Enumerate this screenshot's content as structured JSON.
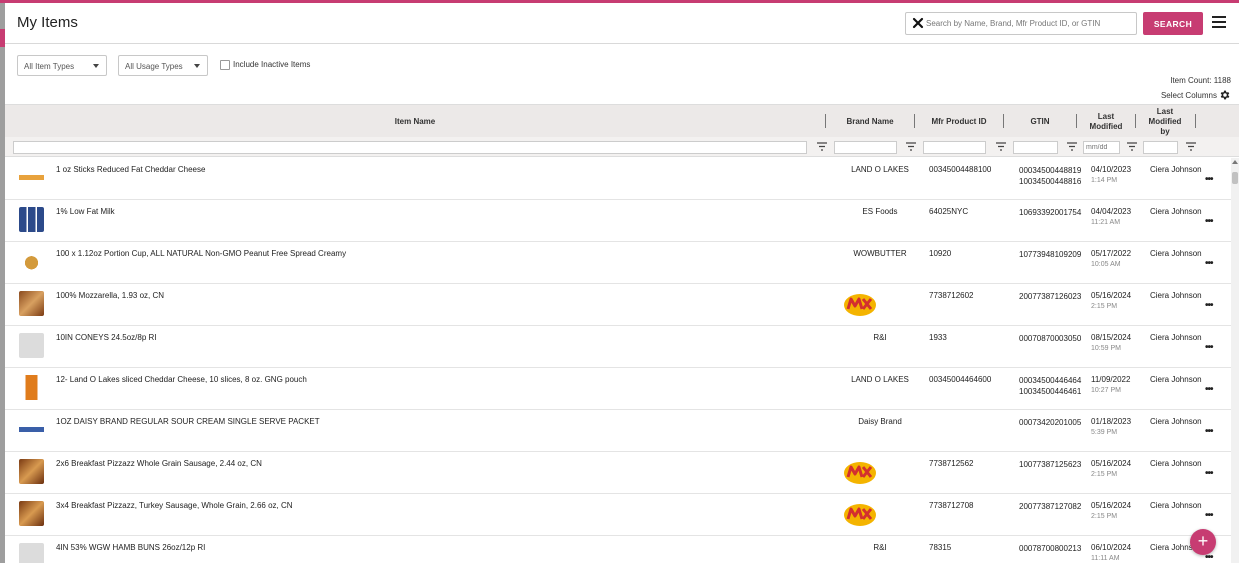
{
  "app": {
    "page_title": "My Items",
    "accent_color": "#c73c72"
  },
  "header": {
    "search_placeholder": "Search by Name, Brand, Mfr Product ID, or GTIN",
    "search_label": "SEARCH"
  },
  "filters": {
    "item_types": "All Item Types",
    "usage_types": "All Usage Types",
    "include_inactive": "Include Inactive Items",
    "include_inactive_checked": false
  },
  "summary": {
    "item_count": "Item Count: 1188",
    "select_columns": "Select Columns"
  },
  "columns": {
    "item_name": "Item Name",
    "brand_name": "Brand Name",
    "mfr_product_id": "Mfr Product ID",
    "gtin": "GTIN",
    "last_modified": "Last Modified",
    "last_modified_by": "Last Modified by",
    "date_filter_placeholder": "mm/dd"
  },
  "rows": [
    {
      "thumb": "cheese-sticks-image",
      "name": "1 oz Sticks Reduced Fat Cheddar Cheese",
      "brand": "LAND O LAKES",
      "mfr": "00345004488100",
      "gtin1": "00034500448819",
      "gtin2": "10034500448816",
      "date": "04/10/2023",
      "time": "1:14 PM",
      "by": "Ciera Johnson",
      "logo": false
    },
    {
      "thumb": "milk-cartons-image",
      "name": "1% Low Fat Milk",
      "brand": "ES Foods",
      "mfr": "64025NYC",
      "gtin1": "10693392001754",
      "gtin2": "",
      "date": "04/04/2023",
      "time": "11:21 AM",
      "by": "Ciera Johnson",
      "logo": false
    },
    {
      "thumb": "peanut-cup-image",
      "name": "100 x 1.12oz Portion Cup, ALL NATURAL Non-GMO Peanut Free Spread Creamy",
      "brand": "WOWBUTTER",
      "mfr": "10920",
      "gtin1": "10773948109209",
      "gtin2": "",
      "date": "05/17/2022",
      "time": "10:05 AM",
      "by": "Ciera Johnson",
      "logo": false
    },
    {
      "thumb": "mozzarella-image",
      "name": "100% Mozzarella, 1.93 oz, CN",
      "brand": "",
      "mfr": "7738712602",
      "gtin1": "20077387126023",
      "gtin2": "",
      "date": "05/16/2024",
      "time": "2:15 PM",
      "by": "Ciera Johnson",
      "logo": true
    },
    {
      "thumb": "placeholder-image",
      "name": "10IN CONEYS 24.5oz/8p RI",
      "brand": "R&I",
      "mfr": "1933",
      "gtin1": "00070870003050",
      "gtin2": "",
      "date": "08/15/2024",
      "time": "10:59 PM",
      "by": "Ciera Johnson",
      "logo": false
    },
    {
      "thumb": "cheddar-pouch-image",
      "name": "12- Land O Lakes sliced Cheddar Cheese, 10 slices, 8 oz. GNG pouch",
      "brand": "LAND O LAKES",
      "mfr": "00345004464600",
      "gtin1": "00034500446464",
      "gtin2": "10034500446461",
      "date": "11/09/2022",
      "time": "10:27 PM",
      "by": "Ciera Johnson",
      "logo": false
    },
    {
      "thumb": "sour-cream-image",
      "name": "1OZ DAISY BRAND REGULAR SOUR CREAM SINGLE SERVE PACKET",
      "brand": "Daisy Brand",
      "mfr": "",
      "gtin1": "00073420201005",
      "gtin2": "",
      "date": "01/18/2023",
      "time": "5:39 PM",
      "by": "Ciera Johnson",
      "logo": false
    },
    {
      "thumb": "pizza-image",
      "name": "2x6 Breakfast Pizzazz Whole Grain Sausage, 2.44 oz, CN",
      "brand": "",
      "mfr": "7738712562",
      "gtin1": "10077387125623",
      "gtin2": "",
      "date": "05/16/2024",
      "time": "2:15 PM",
      "by": "Ciera Johnson",
      "logo": true
    },
    {
      "thumb": "pizza-image",
      "name": "3x4 Breakfast Pizzazz, Turkey Sausage, Whole Grain, 2.66 oz, CN",
      "brand": "",
      "mfr": "7738712708",
      "gtin1": "20077387127082",
      "gtin2": "",
      "date": "05/16/2024",
      "time": "2:15 PM",
      "by": "Ciera Johnson",
      "logo": true
    },
    {
      "thumb": "placeholder-image",
      "name": "4IN 53% WGW HAMB BUNS 26oz/12p RI",
      "brand": "R&I",
      "mfr": "78315",
      "gtin1": "00078700800213",
      "gtin2": "",
      "date": "06/10/2024",
      "time": "11:11 AM",
      "by": "Ciera Johnson",
      "logo": false
    }
  ],
  "fab": {
    "label": "+"
  }
}
